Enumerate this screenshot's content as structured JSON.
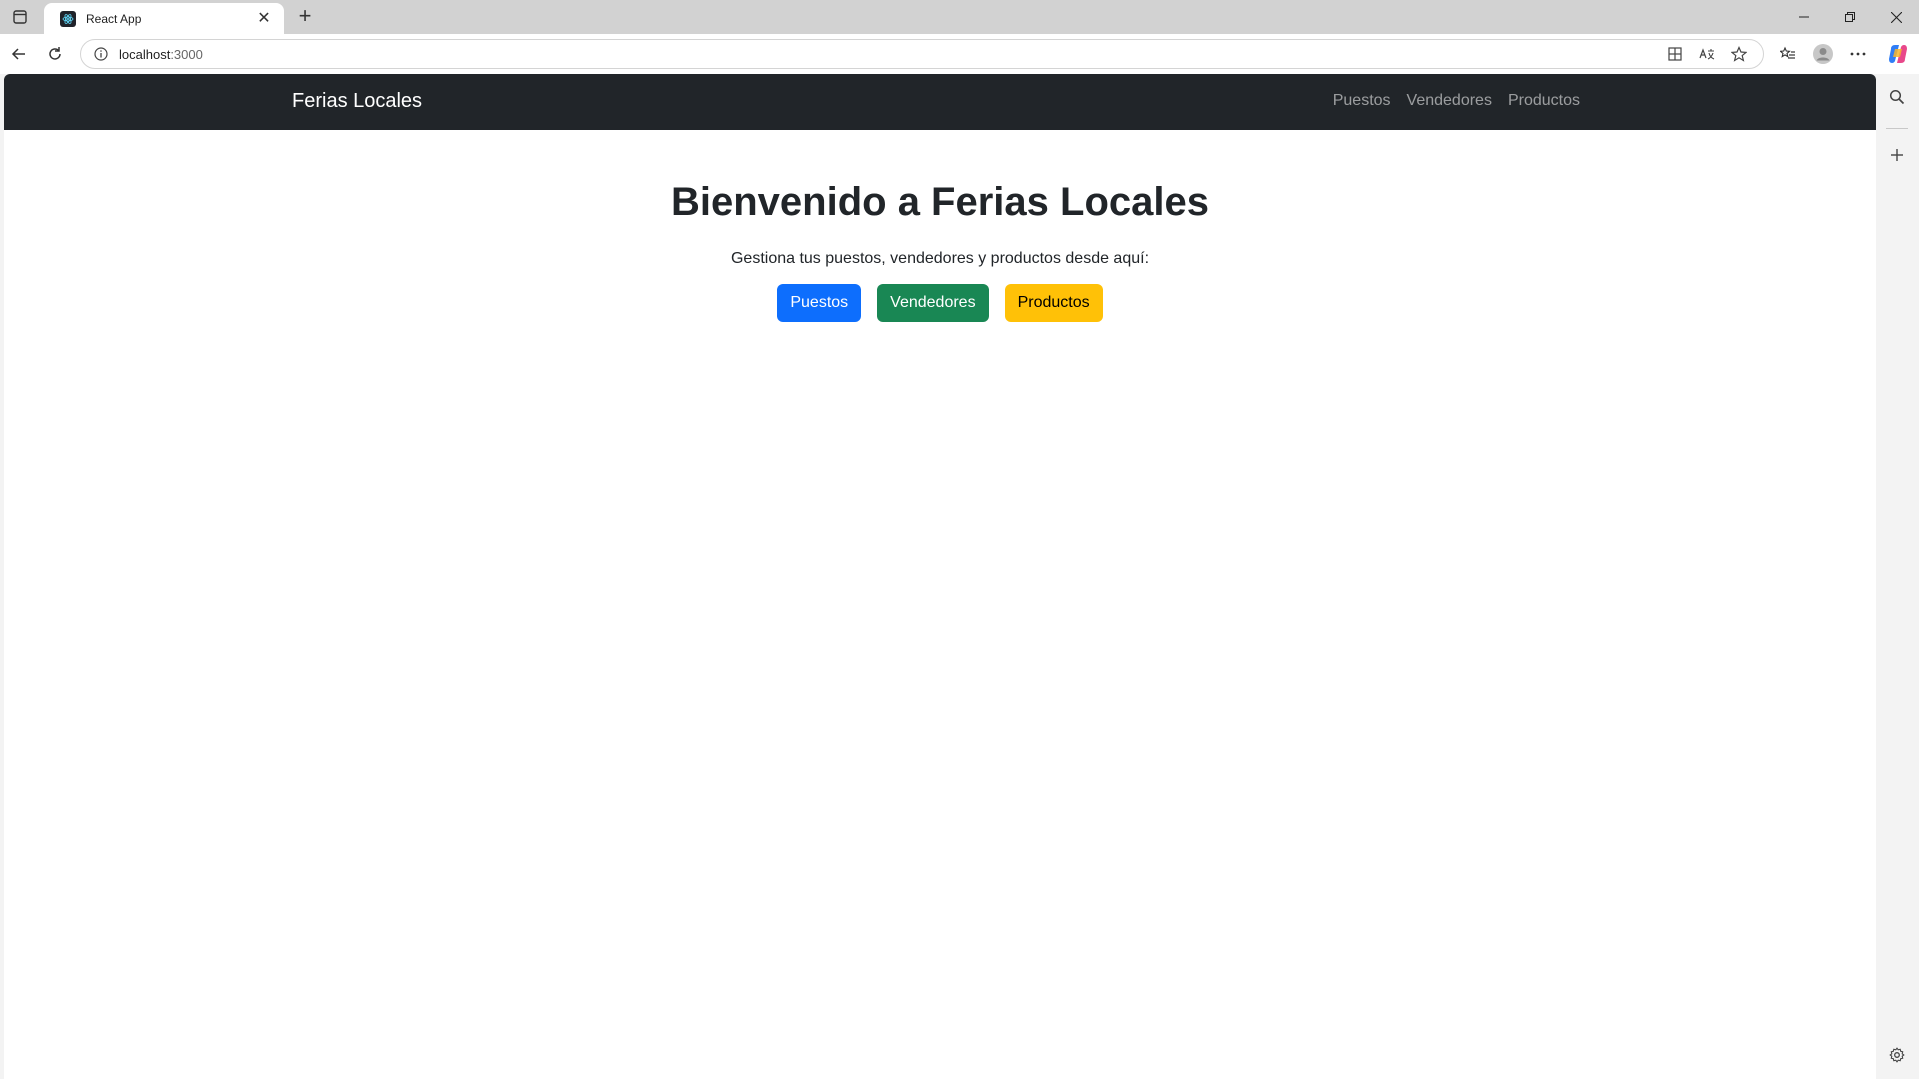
{
  "browser": {
    "tab_title": "React App",
    "url": "localhost",
    "url_port": ":3000"
  },
  "navbar": {
    "brand": "Ferias Locales",
    "links": [
      "Puestos",
      "Vendedores",
      "Productos"
    ]
  },
  "hero": {
    "title": "Bienvenido a Ferias Locales",
    "subtitle": "Gestiona tus puestos, vendedores y productos desde aquí:",
    "buttons": [
      "Puestos",
      "Vendedores",
      "Productos"
    ]
  },
  "colors": {
    "navbar_bg": "#212529",
    "primary": "#0d6efd",
    "success": "#198754",
    "warning": "#ffc107"
  },
  "icons": {
    "tab_actions": "tab-actions-icon",
    "favicon": "react-icon",
    "close": "close-icon",
    "new_tab": "plus-icon",
    "back": "back-arrow-icon",
    "reload": "reload-icon",
    "site_info": "info-icon",
    "app_available": "app-icon",
    "read_aloud": "translate-icon",
    "favorite": "star-icon",
    "favorites": "favorites-icon",
    "profile": "profile-icon",
    "more": "more-icon",
    "copilot": "copilot-icon",
    "search": "search-icon",
    "add": "plus-icon",
    "settings": "gear-icon"
  }
}
